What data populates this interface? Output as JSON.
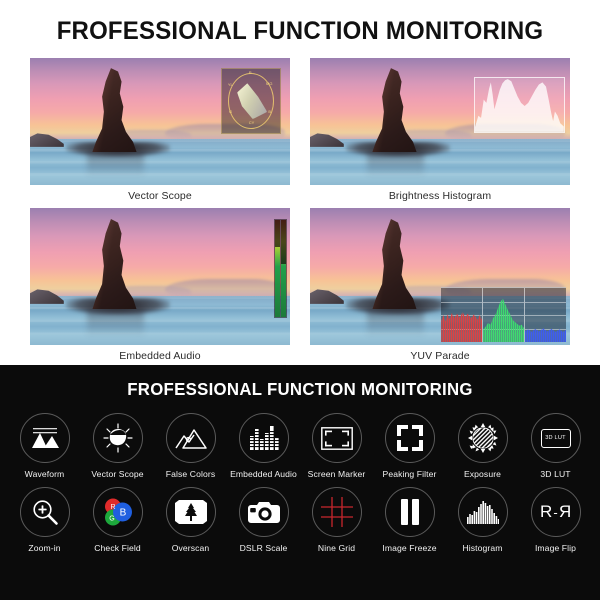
{
  "top": {
    "title": "FROFESSIONAL FUNCTION MONITORING",
    "panels": [
      {
        "label": "Vector Scope",
        "overlay": "vector-scope-overlay"
      },
      {
        "label": "Brightness Histogram",
        "overlay": "histogram-overlay"
      },
      {
        "label": "Embedded Audio",
        "overlay": "audio-meter-overlay"
      },
      {
        "label": "YUV Parade",
        "overlay": "yuv-parade-overlay"
      }
    ],
    "vector_scope_ticks": [
      "R",
      "MG",
      "B",
      "CY",
      "G",
      "YL"
    ]
  },
  "bottom": {
    "title": "FROFESSIONAL FUNCTION MONITORING",
    "features": [
      {
        "label": "Waveform",
        "icon": "waveform-icon"
      },
      {
        "label": "Vector Scope",
        "icon": "vector-scope-icon"
      },
      {
        "label": "False Colors",
        "icon": "false-colors-icon"
      },
      {
        "label": "Embedded Audio",
        "icon": "embedded-audio-icon"
      },
      {
        "label": "Screen Marker",
        "icon": "screen-marker-icon"
      },
      {
        "label": "Peaking Filter",
        "icon": "peaking-filter-icon"
      },
      {
        "label": "Exposure",
        "icon": "exposure-icon"
      },
      {
        "label": "3D LUT",
        "icon": "lut-icon",
        "icon_text": "3D LUT"
      },
      {
        "label": "Zoom-in",
        "icon": "zoom-in-icon"
      },
      {
        "label": "Check Field",
        "icon": "check-field-icon",
        "channels": [
          "R",
          "G",
          "B"
        ]
      },
      {
        "label": "Overscan",
        "icon": "overscan-icon"
      },
      {
        "label": "DSLR Scale",
        "icon": "dslr-scale-icon"
      },
      {
        "label": "Nine Grid",
        "icon": "nine-grid-icon"
      },
      {
        "label": "Image Freeze",
        "icon": "image-freeze-icon"
      },
      {
        "label": "Histogram",
        "icon": "histogram-icon"
      },
      {
        "label": "Image Flip",
        "icon": "image-flip-icon",
        "icon_text": "R-R"
      }
    ]
  },
  "colors": {
    "light_bg": "#ffffff",
    "dark_bg": "#0b0b0b",
    "title_dark": "#111111",
    "title_light": "#ffffff",
    "circle_border": "#5a5a5a",
    "check_red": "#e02b2b",
    "check_green": "#1da83c",
    "check_blue": "#1f5fe0",
    "nine_grid_red": "#c8262c",
    "audio_green": "#23a04a",
    "vector_yellow": "#f0cd6e"
  }
}
